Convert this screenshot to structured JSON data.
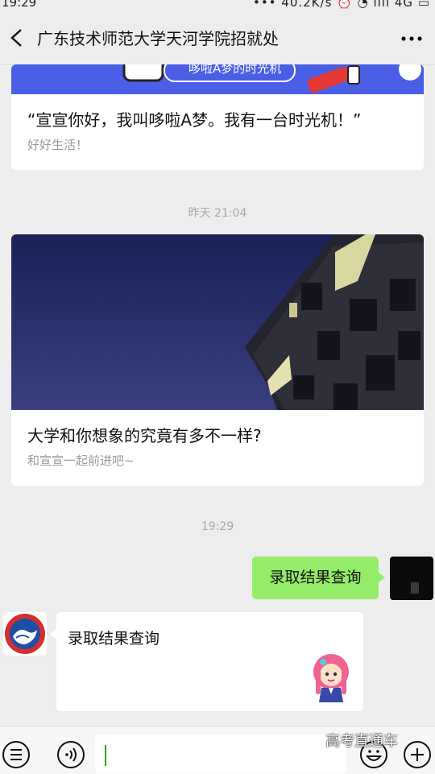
{
  "status": {
    "time": "19:29",
    "right": "••• 40.2K/s  ⏰  ◔  ıııl 4G  ▭"
  },
  "header": {
    "title": "广东技术师范大学天河学院招就处"
  },
  "article1": {
    "banner_text": "哆啦A梦的时光机",
    "title": "“宣宣你好，我叫哆啦A梦。我有一台时光机！”",
    "subtitle": "好好生活！"
  },
  "stamp1": "昨天 21:04",
  "article2": {
    "title": "大学和你想象的究竟有多不一样?",
    "subtitle": "和宣宣一起前进吧~"
  },
  "stamp2": "19:29",
  "outgoing": {
    "text": "录取结果查询"
  },
  "incoming": {
    "text": "录取结果查询"
  },
  "watermark": "高考直通车",
  "colors": {
    "bubble_out": "#95ec69",
    "banner": "#4a5fe6",
    "bg": "#ededed"
  }
}
